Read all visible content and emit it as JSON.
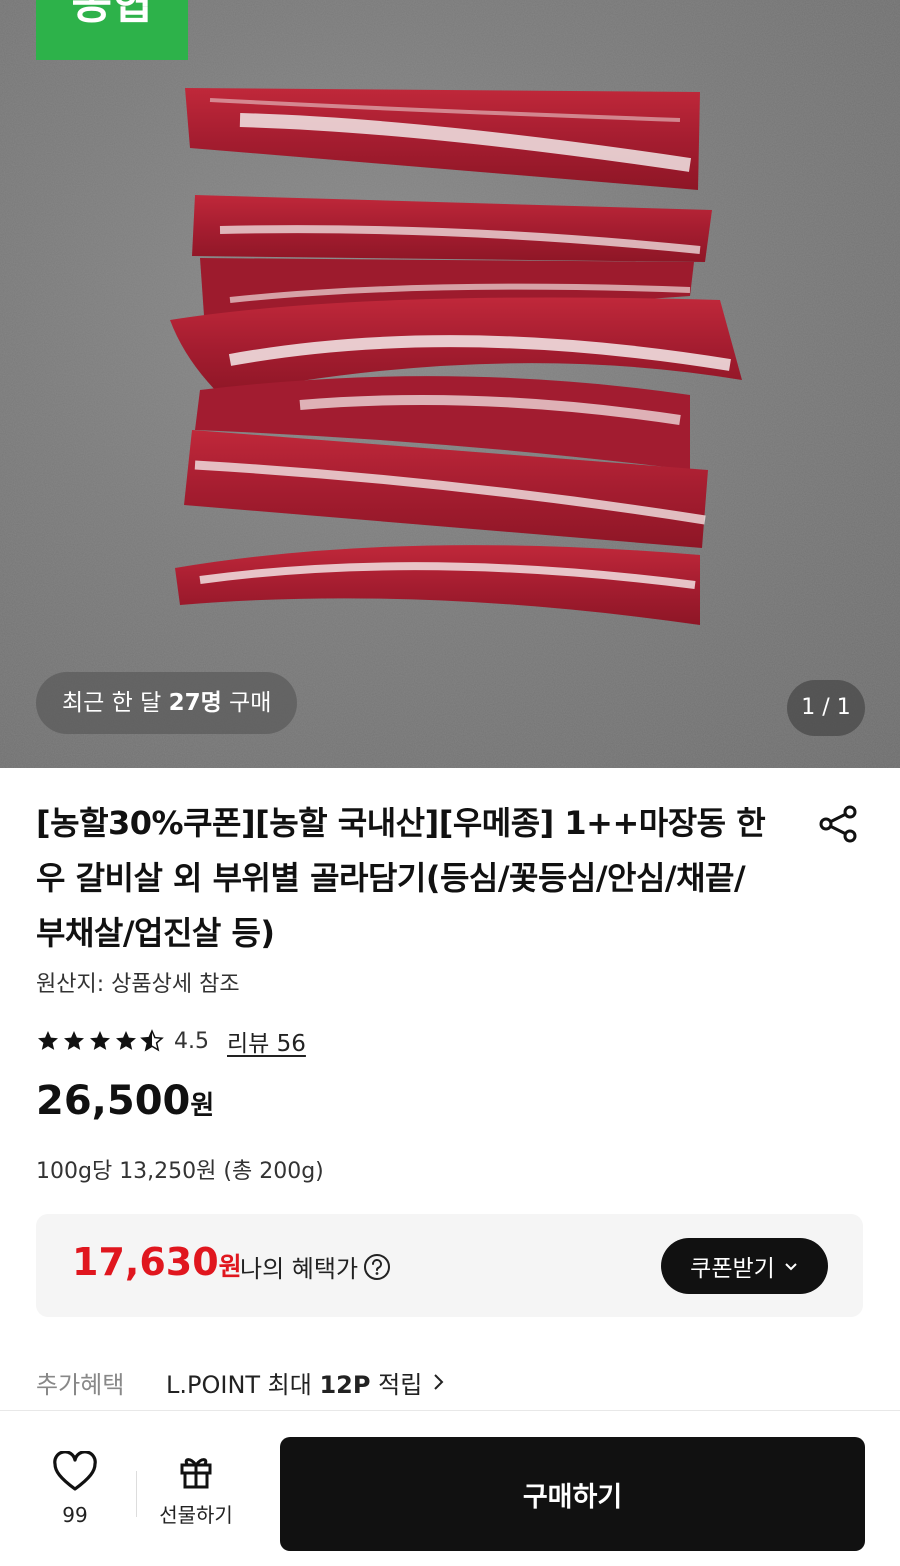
{
  "hero": {
    "recent_purchase_prefix": "최근 한 달 ",
    "recent_purchase_count": "27명",
    "recent_purchase_suffix": " 구매",
    "page_indicator": "1 / 1",
    "brand_badge_text": "농협"
  },
  "product": {
    "title": "[농할30%쿠폰][농할 국내산][우메종] 1++마장동 한우 갈비살 외 부위별 골라담기(등심/꽃등심/안심/채끝/부채살/업진살 등)",
    "origin": "원산지: 상품상세 참조",
    "rating": "4.5",
    "rating_stars_value": 4.5,
    "review_link": "리뷰 56",
    "price": "26,500",
    "price_unit": "원",
    "unit_price": "100g당 13,250원 (총 200g)"
  },
  "benefit": {
    "price": "17,630",
    "price_unit": "원",
    "label": "나의 혜택가",
    "coupon_button": "쿠폰받기"
  },
  "extra": {
    "label": "추가혜택",
    "value_prefix": "L.POINT 최대 ",
    "value_points": "12P",
    "value_suffix": " 적립"
  },
  "bottom_bar": {
    "wish_count": "99",
    "gift_label": "선물하기",
    "buy_button": "구매하기"
  },
  "colors": {
    "brand_green": "#2db24a",
    "benefit_red": "#e0161e",
    "primary_black": "#111111"
  }
}
